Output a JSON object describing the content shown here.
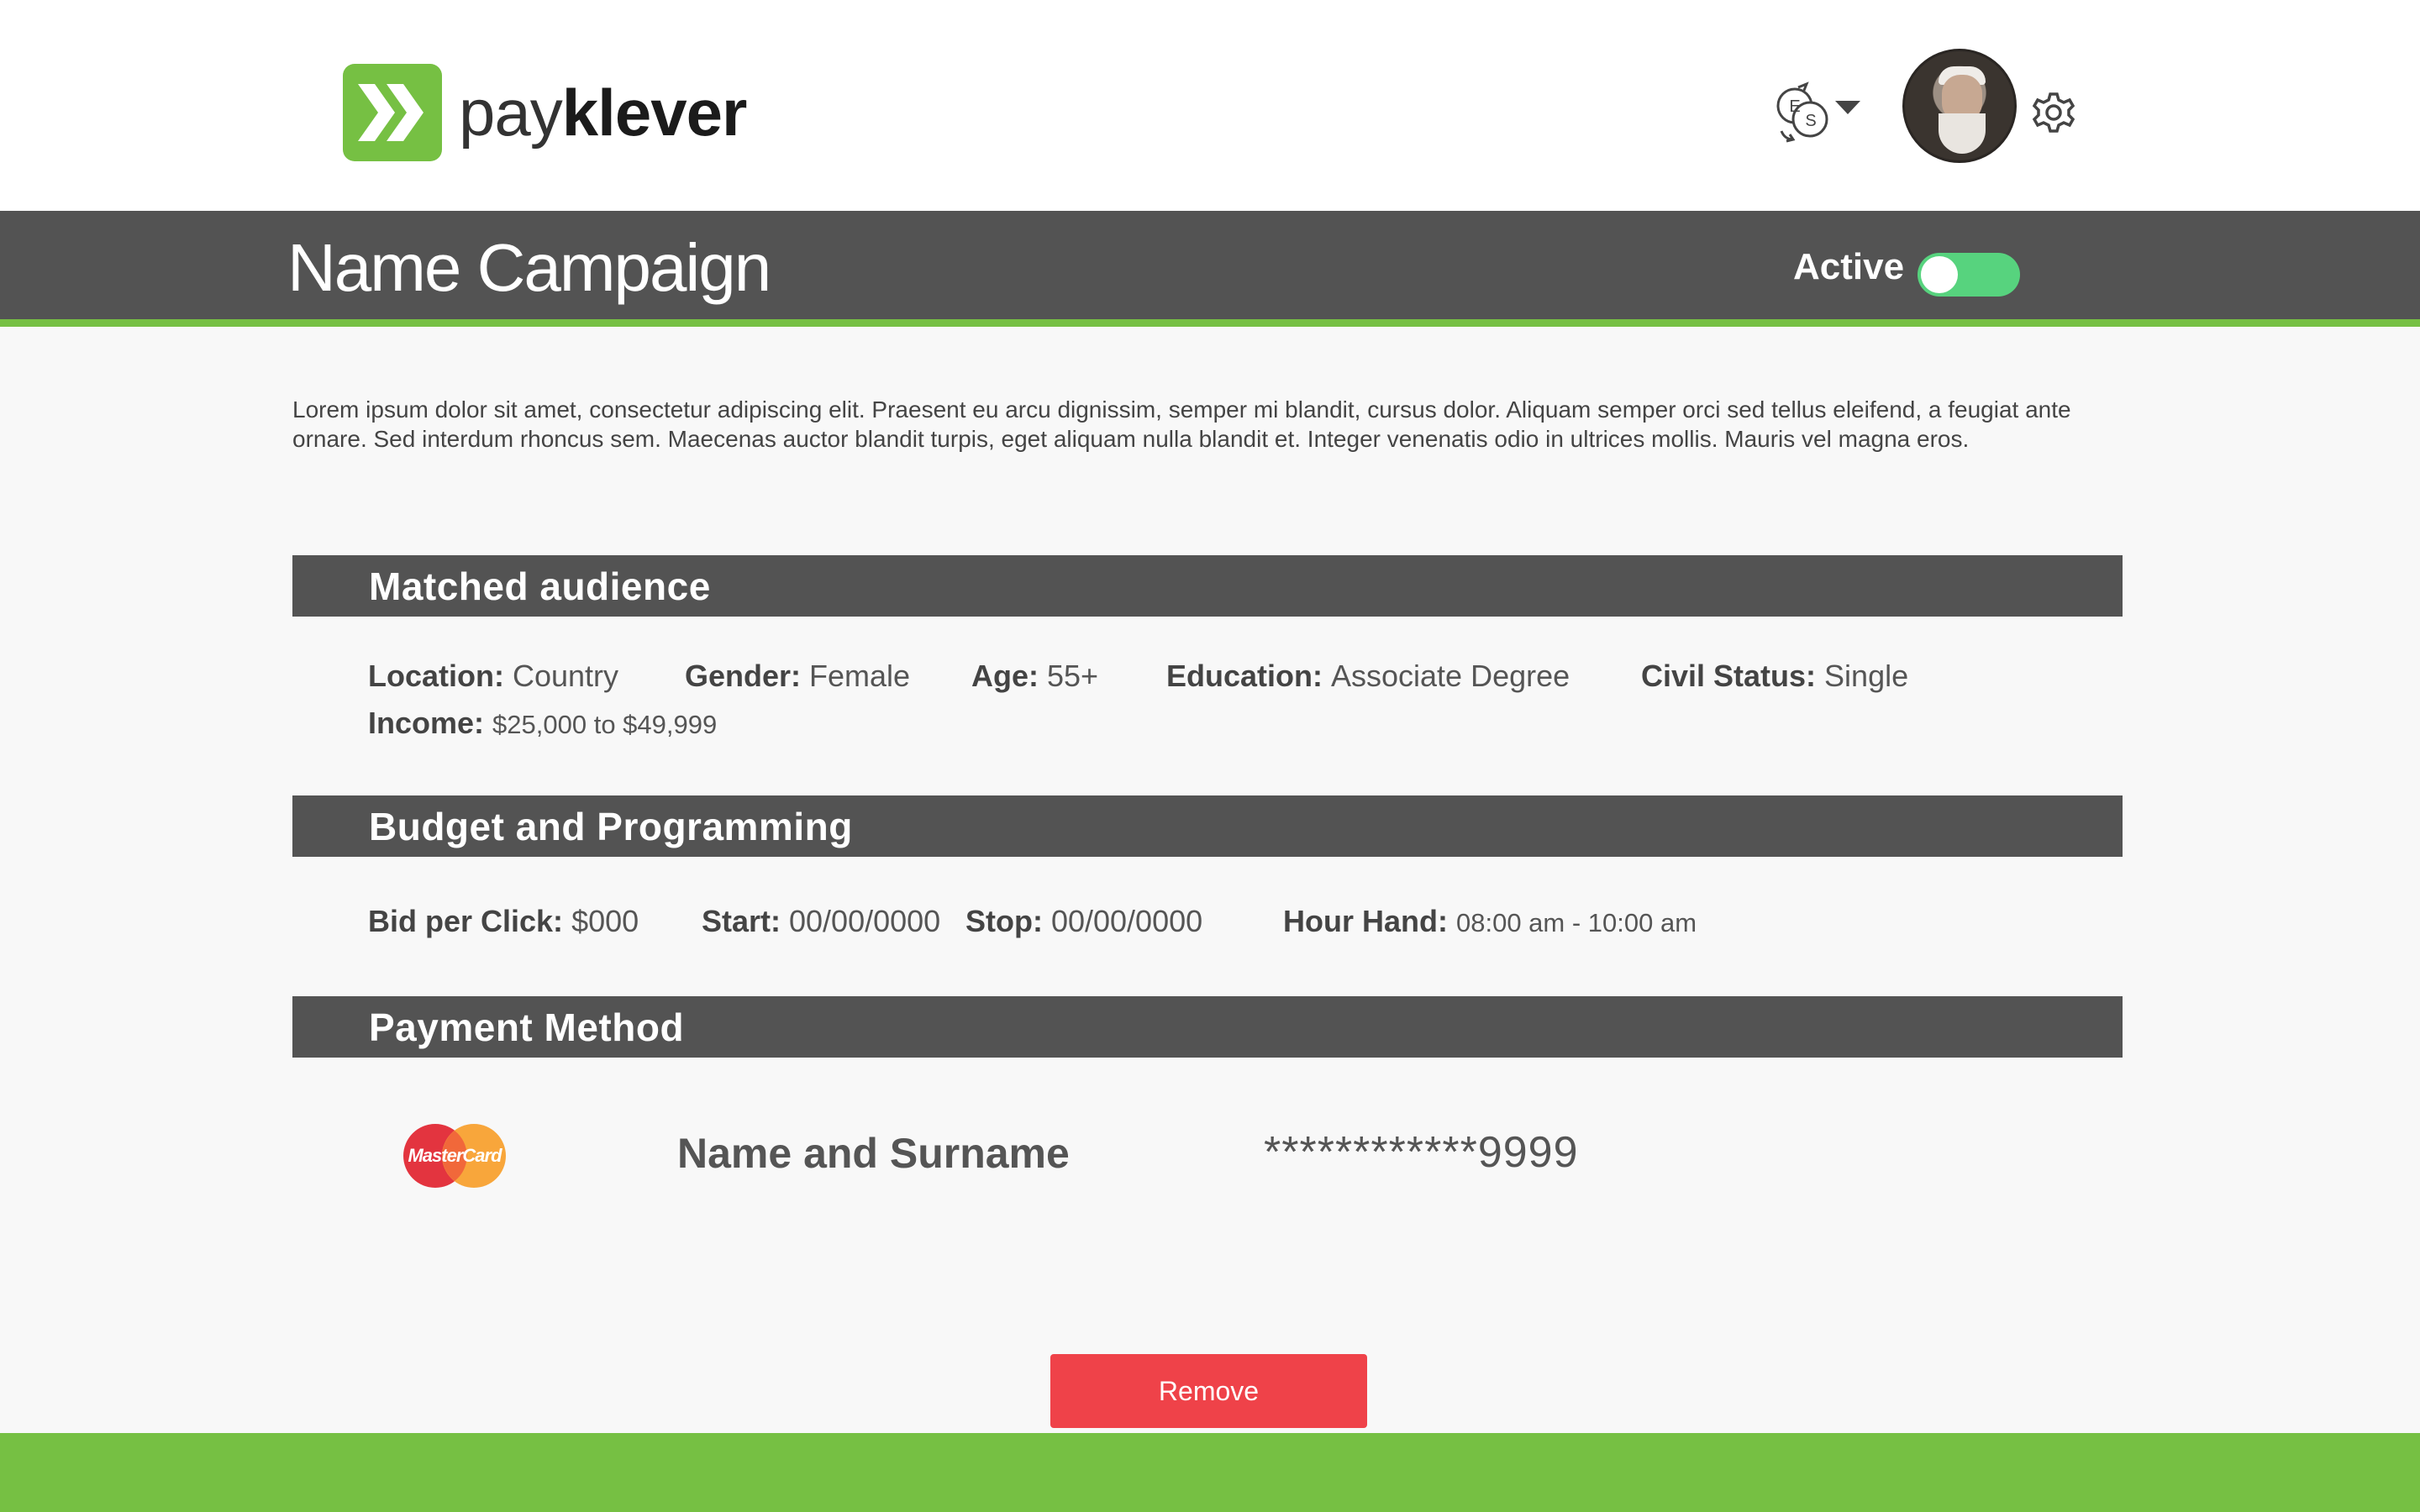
{
  "brand": {
    "name_part1": "pay",
    "name_part2": "klever",
    "color": "#76c043"
  },
  "header": {
    "language_switch_icon": "currency-exchange-icon",
    "language_letters": [
      "E",
      "S"
    ],
    "avatar_alt": "user-avatar",
    "settings_icon": "gear-icon"
  },
  "campaign": {
    "title": "Name Campaign",
    "status_label": "Active",
    "active": true,
    "toggle_color": "#57d37e"
  },
  "description": "Lorem ipsum dolor sit amet, consectetur adipiscing elit. Praesent eu arcu dignissim, semper mi blandit, cursus dolor. Aliquam semper orci sed tellus eleifend, a feugiat ante ornare. Sed interdum rhoncus sem. Maecenas auctor blandit turpis, eget aliquam nulla blandit et. Integer venenatis odio in ultrices mollis. Mauris vel magna eros.",
  "matched_audience": {
    "title": "Matched audience",
    "location_label": "Location:",
    "location_value": "Country",
    "gender_label": "Gender:",
    "gender_value": "Female",
    "age_label": "Age:",
    "age_value": "55+",
    "education_label": "Education:",
    "education_value": "Associate Degree",
    "civil_label": "Civil Status:",
    "civil_value": "Single",
    "income_label": "Income:",
    "income_value": "$25,000 to $49,999"
  },
  "budget": {
    "title": "Budget and Programming",
    "bid_label": "Bid per Click:",
    "bid_value": "$000",
    "start_label": "Start:",
    "start_value": "00/00/0000",
    "stop_label": "Stop:",
    "stop_value": "00/00/0000",
    "hour_label": "Hour Hand:",
    "hour_value": "08:00 am - 10:00 am"
  },
  "payment": {
    "title": "Payment Method",
    "card_brand": "MasterCard",
    "card_holder": "Name and Surname",
    "card_number": "************9999"
  },
  "actions": {
    "remove_label": "Remove",
    "remove_color": "#ef4249"
  }
}
